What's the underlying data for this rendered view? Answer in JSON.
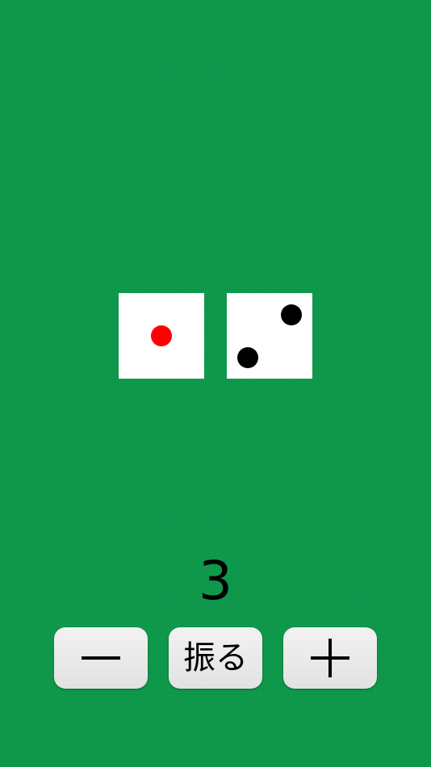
{
  "table": {
    "background_color": "#0d994b"
  },
  "dice": [
    {
      "value": 1,
      "pip_color": "#ff0000"
    },
    {
      "value": 2,
      "pip_color": "#000000"
    }
  ],
  "dice_count": "3",
  "controls": {
    "decrease_icon": "minus-icon",
    "roll_label": "振る",
    "increase_icon": "plus-icon"
  }
}
